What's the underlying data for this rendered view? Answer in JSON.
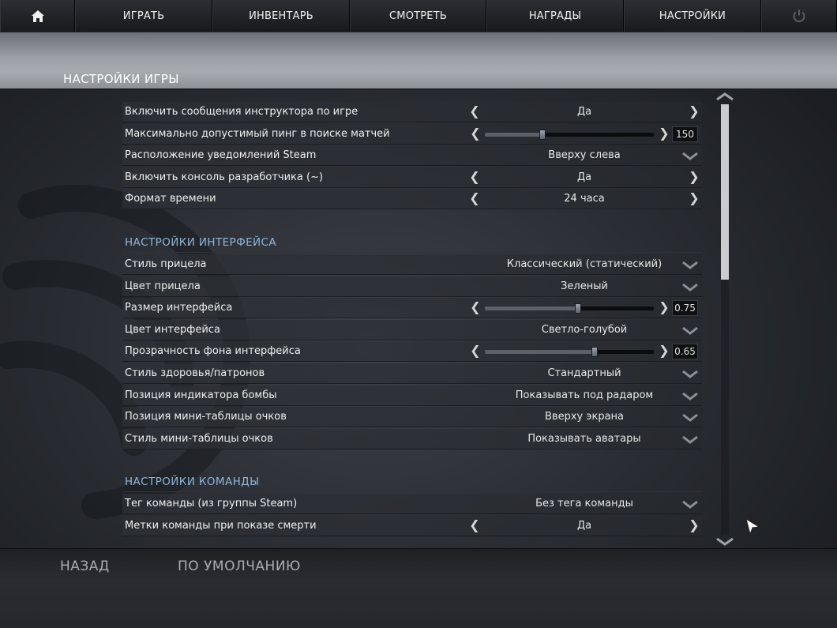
{
  "nav": {
    "home_icon": "home-icon",
    "play": "ИГРАТЬ",
    "inventory": "ИНВЕНТАРЬ",
    "watch": "СМОТРЕТЬ",
    "rewards": "НАГРАДЫ",
    "settings": "НАСТРОЙКИ",
    "power_icon": "power-icon"
  },
  "page_title": "НАСТРОЙКИ ИГРЫ",
  "game_settings": [
    {
      "label": "Включить сообщения инструктора по игре",
      "type": "arrows",
      "value": "Да"
    },
    {
      "label": "Максимально допустимый пинг в поиске матчей",
      "type": "slider",
      "value": "150",
      "fraction": 0.34
    },
    {
      "label": "Расположение уведомлений Steam",
      "type": "dropdown",
      "value": "Вверху слева"
    },
    {
      "label": "Включить консоль разработчика (~)",
      "type": "arrows",
      "value": "Да"
    },
    {
      "label": "Формат времени",
      "type": "arrows",
      "value": "24 часа"
    }
  ],
  "hud_section_title": "НАСТРОЙКИ ИНТЕРФЕЙСА",
  "hud_settings": [
    {
      "label": "Стиль прицела",
      "type": "dropdown",
      "value": "Классический (статический)"
    },
    {
      "label": "Цвет прицела",
      "type": "dropdown",
      "value": "Зеленый"
    },
    {
      "label": "Размер интерфейса",
      "type": "slider",
      "value": "0.75",
      "fraction": 0.55
    },
    {
      "label": "Цвет интерфейса",
      "type": "dropdown",
      "value": "Светло-голубой"
    },
    {
      "label": "Прозрачность фона интерфейса",
      "type": "slider",
      "value": "0.65",
      "fraction": 0.65
    },
    {
      "label": "Стиль здоровья/патронов",
      "type": "dropdown",
      "value": "Стандартный"
    },
    {
      "label": "Позиция индикатора бомбы",
      "type": "dropdown",
      "value": "Показывать под радаром"
    },
    {
      "label": "Позиция мини-таблицы очков",
      "type": "dropdown",
      "value": "Вверху экрана"
    },
    {
      "label": "Стиль мини-таблицы очков",
      "type": "dropdown",
      "value": "Показывать аватары"
    }
  ],
  "team_section_title": "НАСТРОЙКИ КОМАНДЫ",
  "team_settings": [
    {
      "label": "Тег команды (из группы Steam)",
      "type": "dropdown",
      "value": "Без тега команды"
    },
    {
      "label": "Метки команды при показе смерти",
      "type": "arrows",
      "value": "Да"
    }
  ],
  "footer": {
    "back": "НАЗАД",
    "defaults": "ПО УМОЛЧАНИЮ"
  },
  "colors": {
    "section_title": "#8fb6d8",
    "banner": "#a7abb0",
    "scroll_thumb": "#c9cbcf"
  },
  "scroll": {
    "position_fraction": 0.0,
    "visible_fraction": 0.41
  }
}
